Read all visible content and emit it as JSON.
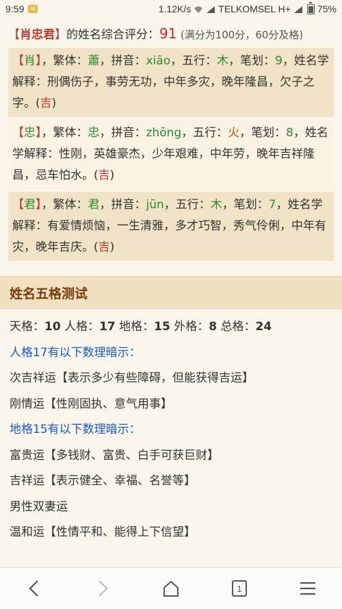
{
  "status_bar": {
    "time": "9:59",
    "speed": "1.12K/s",
    "carrier": "TELKOMSEL H+",
    "battery": "75%"
  },
  "score": {
    "bracket_open": "【",
    "name": "肖忠君",
    "bracket_close": "】",
    "text": "的姓名综合评分：",
    "value": "91",
    "note": "(满分为100分，60分及格)"
  },
  "characters": [
    {
      "char": "肖",
      "label_traditional": "，繁体：",
      "traditional": "蕭",
      "label_pinyin": "，拼音：",
      "pinyin": "xiāo",
      "label_wuxing": "，五行：",
      "wuxing": "木",
      "label_strokes": "，笔划：",
      "strokes": "9",
      "label_meaning": "，姓名学解释：",
      "meaning": "刑偶伤子，事劳无功，中年多灾，晚年隆昌，欠子之字。(",
      "luck": "吉",
      "close": ")"
    },
    {
      "char": "忠",
      "label_traditional": "，繁体：",
      "traditional": "忠",
      "label_pinyin": "，拼音：",
      "pinyin": "zhōng",
      "label_wuxing": "，五行：",
      "wuxing": "火",
      "label_strokes": "，笔划：",
      "strokes": "8",
      "label_meaning": "，姓名学解释：",
      "meaning": "性刚，英雄豪杰，少年艰难，中年劳，晚年吉祥隆昌，忌车怕水。(",
      "luck": "吉",
      "close": ")"
    },
    {
      "char": "君",
      "label_traditional": "，繁体：",
      "traditional": "君",
      "label_pinyin": "，拼音：",
      "pinyin": "jūn",
      "label_wuxing": "，五行：",
      "wuxing": "木",
      "label_strokes": "，笔划：",
      "strokes": "7",
      "label_meaning": "，姓名学解释：",
      "meaning": "有爱情烦恼，一生清雅，多才巧智，秀气伶俐，中年有灾，晚年吉庆。(",
      "luck": "吉",
      "close": ")"
    }
  ],
  "wuge": {
    "title": "姓名五格测试",
    "tian_label": "天格：",
    "tian": "10",
    "ren_label": " 人格：",
    "ren": "17",
    "di_label": " 地格：",
    "di": "15",
    "wai_label": " 外格：",
    "wai": "8",
    "zong_label": " 总格：",
    "zong": "24",
    "ren_hint_title": "人格17有以下数理暗示：",
    "ren_hint_1": "次吉祥运【表示多少有些障碍，但能获得吉运】",
    "ren_hint_2": "刚情运【性刚固执、意气用事】",
    "di_hint_title": "地格15有以下数理暗示：",
    "di_hint_1": "富贵运【多钱财、富贵、白手可获巨财】",
    "di_hint_2": "吉祥运【表示健全、幸福、名誉等】",
    "di_hint_3": "男性双妻运",
    "di_hint_4": "温和运【性情平和、能得上下信望】"
  },
  "nav": {
    "tab_count": "1"
  }
}
